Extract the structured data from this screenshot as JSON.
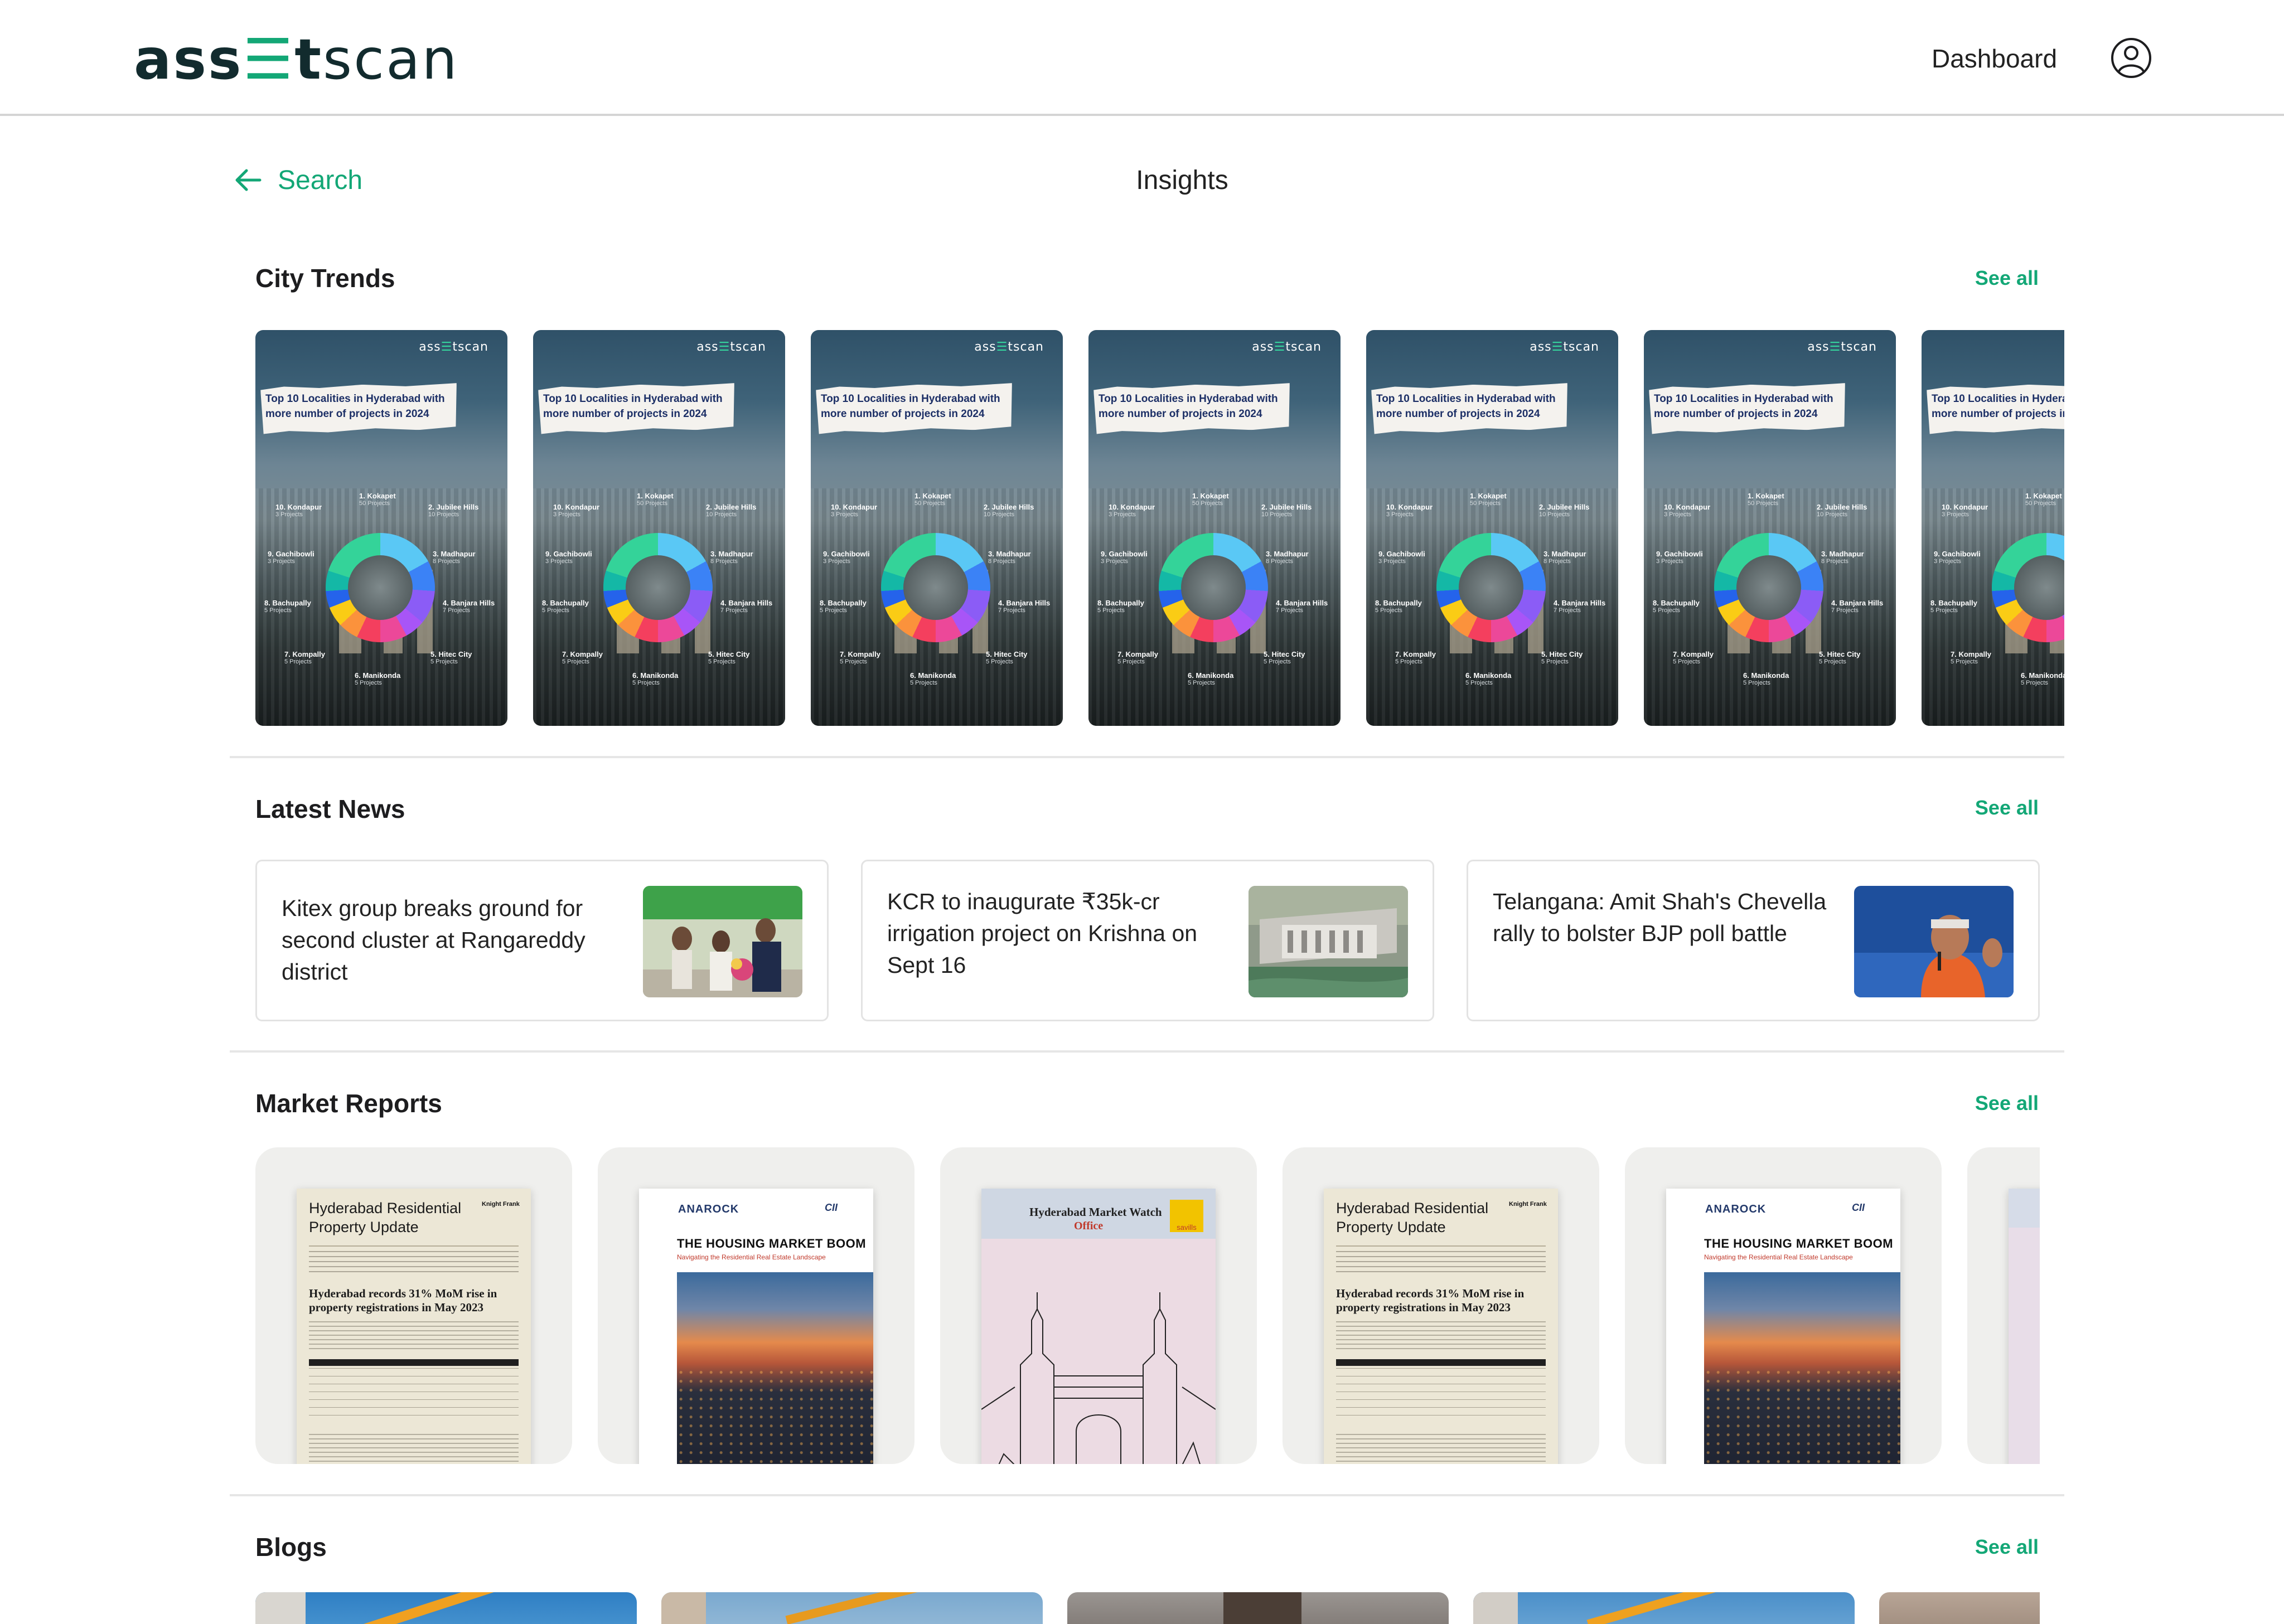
{
  "header": {
    "logo": {
      "part1": "ass",
      "part2": "t",
      "part3": "scan",
      "eq_glyph": "☰"
    },
    "nav_dashboard": "Dashboard",
    "avatar_icon": "user-circle-icon"
  },
  "subheader": {
    "back_label": "Search",
    "back_icon": "arrow-left-icon",
    "page_title": "Insights"
  },
  "sections": {
    "city_trends": {
      "title": "City Trends",
      "see_all": "See all"
    },
    "latest_news": {
      "title": "Latest News",
      "see_all": "See all"
    },
    "market_reports": {
      "title": "Market Reports",
      "see_all": "See all"
    },
    "blogs": {
      "title": "Blogs",
      "see_all": "See all"
    }
  },
  "trend_card": {
    "brand_part1": "ass",
    "brand_part2": "t",
    "brand_part3": "scan",
    "headline": "Top 10 Localities in Hyderabad with more number of projects in 2024",
    "localities": [
      {
        "name": "1. Kokapet",
        "count": "50 Projects"
      },
      {
        "name": "2. Jubilee Hills",
        "count": "10 Projects"
      },
      {
        "name": "3. Madhapur",
        "count": "8 Projects"
      },
      {
        "name": "4. Banjara Hills",
        "count": "7 Projects"
      },
      {
        "name": "5. Hitec City",
        "count": "5 Projects"
      },
      {
        "name": "6. Manikonda",
        "count": "5 Projects"
      },
      {
        "name": "7. Kompally",
        "count": "5 Projects"
      },
      {
        "name": "8. Bachupally",
        "count": "5 Projects"
      },
      {
        "name": "9. Gachibowli",
        "count": "3 Projects"
      },
      {
        "name": "10. Kondapur",
        "count": "3 Projects"
      }
    ],
    "count": 7
  },
  "news": [
    {
      "text": "Kitex group breaks ground for second cluster at Rangareddy district"
    },
    {
      "text": "KCR to inaugurate ₹35k-cr irrigation project on Krishna on Sept 16"
    },
    {
      "text": "Telangana: Amit Shah's Chevella rally to bolster BJP poll battle"
    }
  ],
  "reports": [
    {
      "kind": "kf",
      "title": "Hyderabad Residential Property Update",
      "brand": "Knight Frank",
      "headline": "Hyderabad records 31% MoM rise in property registrations in May 2023"
    },
    {
      "kind": "anarock",
      "brand": "ANAROCK",
      "partner": "CII",
      "title": "THE HOUSING MARKET BOOM",
      "subtitle": "Navigating the Residential Real Estate Landscape"
    },
    {
      "kind": "savills",
      "title": "Hyderabad Market Watch",
      "subtitle": "Office",
      "brand": "savills"
    },
    {
      "kind": "kf",
      "title": "Hyderabad Residential Property Update",
      "brand": "Knight Frank",
      "headline": "Hyderabad records 31% MoM rise in property registrations in May 2023"
    },
    {
      "kind": "anarock",
      "brand": "ANAROCK",
      "partner": "CII",
      "title": "THE HOUSING MARKET BOOM",
      "subtitle": "Navigating the Residential Real Estate Landscape"
    },
    {
      "kind": "partial"
    }
  ],
  "colors": {
    "accent": "#13a776",
    "logo_dark": "#122b2e",
    "divider": "#e6e6e6"
  }
}
